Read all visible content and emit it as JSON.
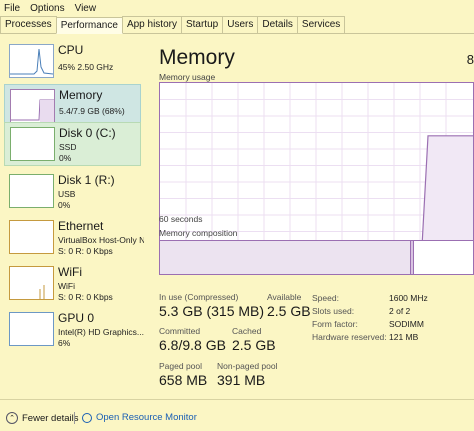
{
  "menu": {
    "file": "File",
    "options": "Options",
    "view": "View"
  },
  "tabs": [
    "Processes",
    "Performance",
    "App history",
    "Startup",
    "Users",
    "Details",
    "Services"
  ],
  "sidebar": {
    "items": [
      {
        "title": "CPU",
        "sub1": "45%  2.50 GHz",
        "sub2": ""
      },
      {
        "title": "Memory",
        "sub1": "5.4/7.9 GB (68%)",
        "sub2": ""
      },
      {
        "title": "Disk 0 (C:)",
        "sub1": "SSD",
        "sub2": "0%"
      },
      {
        "title": "Disk 1 (R:)",
        "sub1": "USB",
        "sub2": "0%"
      },
      {
        "title": "Ethernet",
        "sub1": "VirtualBox Host-Only N",
        "sub2": "S: 0  R: 0 Kbps"
      },
      {
        "title": "WiFi",
        "sub1": "WiFi",
        "sub2": "S: 0  R: 0 Kbps"
      },
      {
        "title": "GPU 0",
        "sub1": "Intel(R) HD Graphics...",
        "sub2": "6%"
      }
    ]
  },
  "main": {
    "title": "Memory",
    "title_right": "8",
    "usage_label": "Memory usage",
    "time_label": "60 seconds",
    "composition_label": "Memory composition",
    "usage_level": 0.68,
    "stats": {
      "in_use_label": "In use (Compressed)",
      "in_use_value": "5.3 GB (315 MB)",
      "available_label": "Available",
      "available_value": "2.5 GB",
      "committed_label": "Committed",
      "committed_value": "6.8/9.8 GB",
      "cached_label": "Cached",
      "cached_value": "2.5 GB",
      "paged_label": "Paged pool",
      "paged_value": "658 MB",
      "nonpaged_label": "Non-paged pool",
      "nonpaged_value": "391 MB"
    },
    "details": {
      "speed_label": "Speed:",
      "speed_value": "1600 MHz",
      "slots_label": "Slots used:",
      "slots_value": "2 of 2",
      "form_label": "Form factor:",
      "form_value": "SODIMM",
      "reserved_label": "Hardware reserved:",
      "reserved_value": "121 MB"
    }
  },
  "footer": {
    "fewer_details": "Fewer details",
    "open_monitor": "Open Resource Monitor"
  },
  "colors": {
    "background": "#fbf6c4",
    "memory_accent": "#9b6fb2",
    "selected_memory": "#cfe6e3",
    "selected_disk": "#daeed6",
    "link": "#1a5fb4"
  }
}
